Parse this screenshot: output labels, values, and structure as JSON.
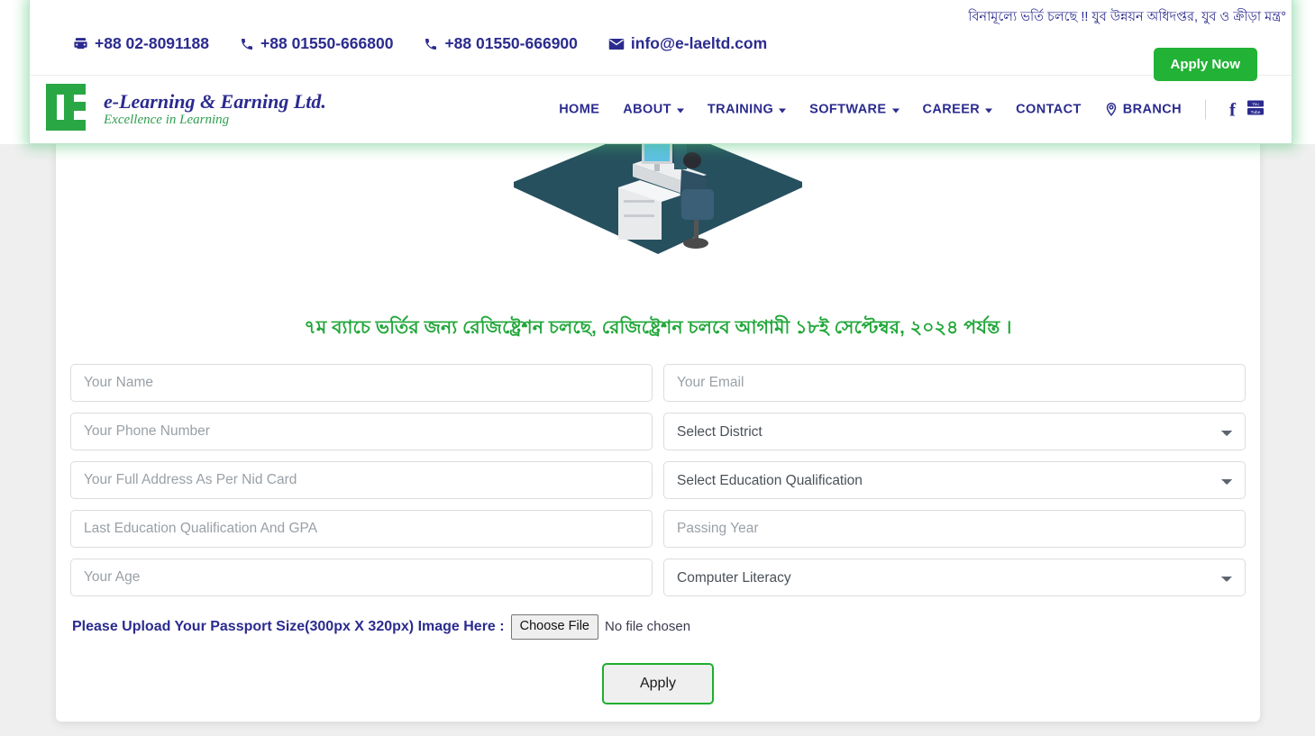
{
  "header": {
    "marquee_text": "বিনামূল্যে ভর্তি চলছে !! যুব উন্নয়ন অধিদপ্তর, যুব ও ক্রীড়া মন্ত্র°",
    "contacts": [
      {
        "icon": "telephone-icon",
        "label": "+88 02-8091188"
      },
      {
        "icon": "phone-icon",
        "label": "+88 01550-666800"
      },
      {
        "icon": "phone-icon",
        "label": "+88 01550-666900"
      },
      {
        "icon": "envelope-icon",
        "label": "info@e-laeltd.com"
      }
    ],
    "apply_now_label": "Apply Now",
    "brand": {
      "logo_text": "EL",
      "title": "e-Learning & Earning Ltd.",
      "tagline": "Excellence in Learning"
    },
    "nav": [
      {
        "label": "HOME",
        "has_dropdown": false
      },
      {
        "label": "ABOUT",
        "has_dropdown": true
      },
      {
        "label": "TRAINING",
        "has_dropdown": true
      },
      {
        "label": "SOFTWARE",
        "has_dropdown": true
      },
      {
        "label": "CAREER",
        "has_dropdown": true
      },
      {
        "label": "CONTACT",
        "has_dropdown": false
      },
      {
        "label": "BRANCH",
        "has_dropdown": false,
        "icon": "map-pin-icon"
      }
    ],
    "social": [
      {
        "name": "facebook-icon",
        "label": "f"
      },
      {
        "name": "youtube-icon",
        "label": "You Tube"
      }
    ]
  },
  "main": {
    "illustration_alt": "isometric computer training classroom illustration",
    "headline": "৭ম ব্যাচে ভর্তির জন্য রেজিষ্ট্রেশন চলছে, রেজিষ্ট্রেশন চলবে আগামী ১৮ই সেপ্টেম্বর, ২০২৪ পর্যন্ত ।",
    "form": {
      "fields": [
        {
          "name": "your-name",
          "type": "text",
          "placeholder": "Your Name",
          "value": ""
        },
        {
          "name": "your-email",
          "type": "text",
          "placeholder": "Your Email",
          "value": ""
        },
        {
          "name": "your-phone",
          "type": "text",
          "placeholder": "Your Phone Number",
          "value": ""
        },
        {
          "name": "district",
          "type": "select",
          "placeholder": "Select District",
          "value": "Select District"
        },
        {
          "name": "address",
          "type": "text",
          "placeholder": "Your Full Address As Per Nid Card",
          "value": ""
        },
        {
          "name": "education",
          "type": "select",
          "placeholder": "Select Education Qualification",
          "value": "Select Education Qualification"
        },
        {
          "name": "last-edu-gpa",
          "type": "text",
          "placeholder": "Last Education Qualification And GPA",
          "value": ""
        },
        {
          "name": "passing-year",
          "type": "text",
          "placeholder": "Passing Year",
          "value": ""
        },
        {
          "name": "your-age",
          "type": "text",
          "placeholder": "Your Age",
          "value": ""
        },
        {
          "name": "computer-literacy",
          "type": "select",
          "placeholder": "Computer Literacy",
          "value": "Computer Literacy"
        }
      ],
      "upload_label": "Please Upload Your Passport Size(300px X 320px) Image Here :",
      "choose_file_label": "Choose File",
      "file_status": "No file chosen",
      "submit_label": "Apply"
    }
  },
  "colors": {
    "brand_green": "#22b236",
    "headline_green": "#21a73a",
    "navy": "#2b2b8f",
    "field_border": "#dcdcdc"
  }
}
